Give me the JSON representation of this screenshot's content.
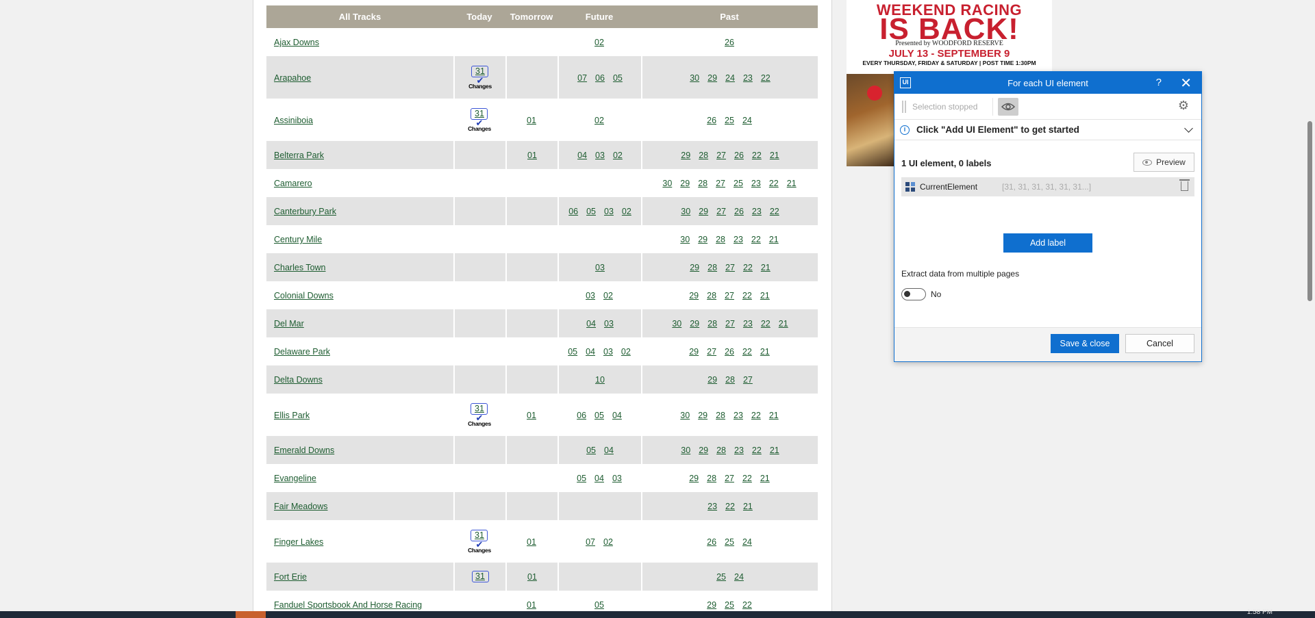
{
  "table": {
    "headers": [
      "All Tracks",
      "Today",
      "Tomorrow",
      "Future",
      "Past"
    ],
    "changes_label": "Changes",
    "rows": [
      {
        "name": "Ajax Downs",
        "today": "",
        "changes": false,
        "tomorrow": "",
        "future": [
          "02"
        ],
        "past": [
          "26"
        ],
        "height": 41
      },
      {
        "name": "Arapahoe",
        "today": "31",
        "changes": true,
        "tomorrow": "",
        "future": [
          "07",
          "06",
          "05"
        ],
        "past": [
          "30",
          "29",
          "24",
          "23",
          "22"
        ],
        "height": 62
      },
      {
        "name": "Assiniboia",
        "today": "31",
        "changes": true,
        "tomorrow": "01",
        "future": [
          "02"
        ],
        "past": [
          "26",
          "25",
          "24"
        ],
        "height": 62
      },
      {
        "name": "Belterra Park",
        "today": "",
        "changes": false,
        "tomorrow": "01",
        "future": [
          "04",
          "03",
          "02"
        ],
        "past": [
          "29",
          "28",
          "27",
          "26",
          "22",
          "21"
        ],
        "height": 41
      },
      {
        "name": "Camarero",
        "today": "",
        "changes": false,
        "tomorrow": "",
        "future": [],
        "past": [
          "30",
          "29",
          "28",
          "27",
          "25",
          "23",
          "22",
          "21"
        ],
        "height": 41
      },
      {
        "name": "Canterbury Park",
        "today": "",
        "changes": false,
        "tomorrow": "",
        "future": [
          "06",
          "05",
          "03",
          "02"
        ],
        "past": [
          "30",
          "29",
          "27",
          "26",
          "23",
          "22"
        ],
        "height": 41
      },
      {
        "name": "Century Mile",
        "today": "",
        "changes": false,
        "tomorrow": "",
        "future": [],
        "past": [
          "30",
          "29",
          "28",
          "23",
          "22",
          "21"
        ],
        "height": 41
      },
      {
        "name": "Charles Town",
        "today": "",
        "changes": false,
        "tomorrow": "",
        "future": [
          "03"
        ],
        "past": [
          "29",
          "28",
          "27",
          "22",
          "21"
        ],
        "height": 41
      },
      {
        "name": "Colonial Downs",
        "today": "",
        "changes": false,
        "tomorrow": "",
        "future": [
          "03",
          "02"
        ],
        "past": [
          "29",
          "28",
          "27",
          "22",
          "21"
        ],
        "height": 41
      },
      {
        "name": "Del Mar",
        "today": "",
        "changes": false,
        "tomorrow": "",
        "future": [
          "04",
          "03"
        ],
        "past": [
          "30",
          "29",
          "28",
          "27",
          "23",
          "22",
          "21"
        ],
        "height": 41
      },
      {
        "name": "Delaware Park",
        "today": "",
        "changes": false,
        "tomorrow": "",
        "future": [
          "05",
          "04",
          "03",
          "02"
        ],
        "past": [
          "29",
          "27",
          "26",
          "22",
          "21"
        ],
        "height": 41
      },
      {
        "name": "Delta Downs",
        "today": "",
        "changes": false,
        "tomorrow": "",
        "future": [
          "10"
        ],
        "past": [
          "29",
          "28",
          "27"
        ],
        "height": 41
      },
      {
        "name": "Ellis Park",
        "today": "31",
        "changes": true,
        "tomorrow": "01",
        "future": [
          "06",
          "05",
          "04"
        ],
        "past": [
          "30",
          "29",
          "28",
          "23",
          "22",
          "21"
        ],
        "height": 62
      },
      {
        "name": "Emerald Downs",
        "today": "",
        "changes": false,
        "tomorrow": "",
        "future": [
          "05",
          "04"
        ],
        "past": [
          "30",
          "29",
          "28",
          "23",
          "22",
          "21"
        ],
        "height": 41
      },
      {
        "name": "Evangeline",
        "today": "",
        "changes": false,
        "tomorrow": "",
        "future": [
          "05",
          "04",
          "03"
        ],
        "past": [
          "29",
          "28",
          "27",
          "22",
          "21"
        ],
        "height": 41
      },
      {
        "name": "Fair Meadows",
        "today": "",
        "changes": false,
        "tomorrow": "",
        "future": [],
        "past": [
          "23",
          "22",
          "21"
        ],
        "height": 41
      },
      {
        "name": "Finger Lakes",
        "today": "31",
        "changes": true,
        "tomorrow": "01",
        "future": [
          "07",
          "02"
        ],
        "past": [
          "26",
          "25",
          "24"
        ],
        "height": 62
      },
      {
        "name": "Fort Erie",
        "today": "31",
        "changes": false,
        "tomorrow": "01",
        "future": [],
        "past": [
          "25",
          "24"
        ],
        "height": 41
      },
      {
        "name": "Fanduel Sportsbook And Horse Racing",
        "today": "",
        "changes": false,
        "tomorrow": "01",
        "future": [
          "05"
        ],
        "past": [
          "29",
          "25",
          "22"
        ],
        "height": 41
      }
    ]
  },
  "ad": {
    "line1": "WEEKEND RACING",
    "line2": "IS BACK!",
    "line3": "Presented by WOODFORD RESERVE",
    "line4": "JULY 13 - SEPTEMBER 9",
    "line5": "EVERY THURSDAY, FRIDAY & SATURDAY | POST TIME 1:30PM"
  },
  "dialog": {
    "icon_text": "UI",
    "title": "For each UI element",
    "help": "?",
    "close": "✕",
    "selection_status": "Selection stopped",
    "info_message": "Click \"Add UI Element\" to get started",
    "count_label": "1 UI element, 0 labels",
    "preview_label": "Preview",
    "element_name": "CurrentElement",
    "element_values": "[31, 31, 31, 31, 31, 31...]",
    "add_label_button": "Add label",
    "extract_label": "Extract data from multiple pages",
    "toggle_state": "No",
    "save_button": "Save & close",
    "cancel_button": "Cancel"
  },
  "taskbar": {
    "time": "1:58 PM"
  },
  "colors": {
    "header_bg": "#aca697",
    "row_alt": "#e3e3e3",
    "link": "#1d5c30",
    "accent_blue": "#0f6fcf",
    "calendar_blue": "#3b55d6",
    "ad_red": "#c8202f"
  }
}
